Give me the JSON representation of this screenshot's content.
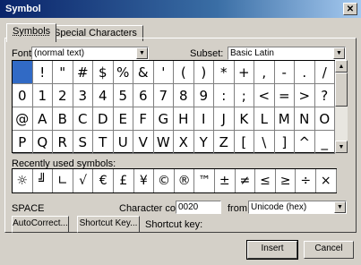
{
  "window": {
    "title": "Symbol",
    "close_glyph": "✕"
  },
  "tabs": [
    {
      "label": "Symbols",
      "active": true
    },
    {
      "label": "Special Characters",
      "active": false
    }
  ],
  "font": {
    "label": "Font:",
    "value": "(normal text)"
  },
  "subset": {
    "label": "Subset:",
    "value": "Basic Latin"
  },
  "symbol_grid": {
    "selected_index": 0,
    "rows": [
      [
        " ",
        "!",
        "\"",
        "#",
        "$",
        "%",
        "&",
        "'",
        "(",
        ")",
        "*",
        "+",
        ",",
        "-",
        ".",
        "/"
      ],
      [
        "0",
        "1",
        "2",
        "3",
        "4",
        "5",
        "6",
        "7",
        "8",
        "9",
        ":",
        ";",
        "<",
        "=",
        ">",
        "?"
      ],
      [
        "@",
        "A",
        "B",
        "C",
        "D",
        "E",
        "F",
        "G",
        "H",
        "I",
        "J",
        "K",
        "L",
        "M",
        "N",
        "O"
      ],
      [
        "P",
        "Q",
        "R",
        "S",
        "T",
        "U",
        "V",
        "W",
        "X",
        "Y",
        "Z",
        "[",
        "\\",
        "]",
        "^",
        "_"
      ]
    ]
  },
  "scrollbar": {
    "up_glyph": "▲",
    "down_glyph": "▼"
  },
  "recent": {
    "label": "Recently used symbols:",
    "symbols": [
      "☼",
      "╝",
      "∟",
      "√",
      "€",
      "£",
      "¥",
      "©",
      "®",
      "™",
      "±",
      "≠",
      "≤",
      "≥",
      "÷",
      "×"
    ]
  },
  "char_name": "SPACE",
  "char_code": {
    "label": "Character code:",
    "value": "0020"
  },
  "from": {
    "label": "from:",
    "value": "Unicode (hex)"
  },
  "buttons": {
    "autocorrect": "AutoCorrect...",
    "shortcut_key": "Shortcut Key...",
    "insert": "Insert",
    "cancel": "Cancel"
  },
  "shortcut_label": "Shortcut key:",
  "combo_arrow_glyph": "▼"
}
